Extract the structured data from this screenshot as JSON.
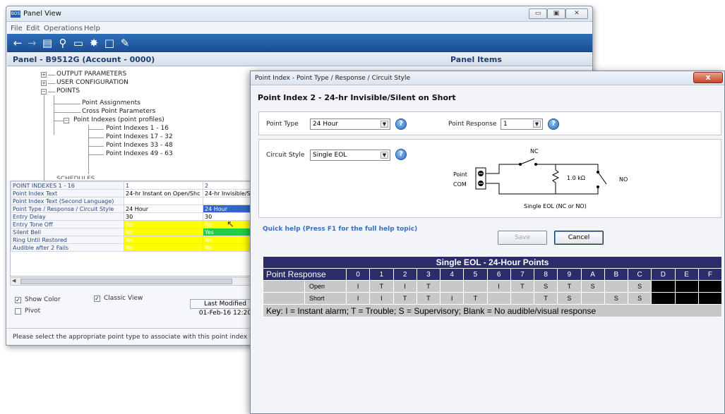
{
  "main_window": {
    "title": "Panel View",
    "app_icon_text": "BOS",
    "caption_buttons": {
      "minimize": "▭",
      "maximize": "▣",
      "close": "✕"
    },
    "menu": [
      "File",
      "Edit",
      "Operations",
      "Help"
    ],
    "toolbar_icons": [
      "back-arrow-icon",
      "forward-arrow-icon",
      "preview-icon",
      "search-icon",
      "page-security-icon",
      "tools-icon",
      "document-icon",
      "edit-document-icon"
    ],
    "panel_title": "Panel - B9512G (Account - 0000)",
    "panel_items_title": "Panel Items",
    "tree": {
      "output_parameters": "OUTPUT PARAMETERS",
      "user_configuration": "USER CONFIGURATION",
      "points": "POINTS",
      "point_assignments": "Point Assignments",
      "cross_point": "Cross Point Parameters",
      "point_indexes": "Point Indexes (point profiles)",
      "pi_1_16": "Point Indexes 1 - 16",
      "pi_17_32": "Point Indexes 17 - 32",
      "pi_33_48": "Point Indexes 33 - 48",
      "pi_49_63": "Point Indexes 49 - 63",
      "schedules_partial": "SCHEDULES"
    },
    "grid": {
      "header": [
        "POINT INDEXES 1 - 16",
        "1",
        "2"
      ],
      "rows": [
        {
          "label": "Point Index Text",
          "c1": "24-hr Instant on Open/Shc",
          "c2": "24-hr Invisible/S"
        },
        {
          "label": "Point Index Text (Second Language)",
          "c1": "",
          "c2": ""
        },
        {
          "label": "Point Type / Response / Circuit Style",
          "c1": "24 Hour",
          "c2": "24 Hour"
        },
        {
          "label": "Entry Delay",
          "c1": "30",
          "c2": "30"
        },
        {
          "label": "Entry Tone Off",
          "c1": "No",
          "c2": "No"
        },
        {
          "label": "Silent Bell",
          "c1": "No",
          "c2": "Yes"
        },
        {
          "label": "Ring Until Restored",
          "c1": "No",
          "c2": "No"
        },
        {
          "label": "Audible after 2 Fails",
          "c1": "No",
          "c2": "No"
        }
      ]
    },
    "show_color_label": "Show Color",
    "classic_view_label": "Classic View",
    "pivot_label": "Pivot",
    "last_modified_label": "Last Modified",
    "last_modified_value": "01-Feb-16 12:20",
    "status_text": "Please select the appropriate point type to associate with this point index from the d"
  },
  "dialog": {
    "title": "Point Index - Point Type / Response / Circuit Style",
    "close_label": "x",
    "heading": "Point Index 2 - 24-hr Invisible/Silent on Short",
    "point_type_label": "Point Type",
    "point_type_value": "24 Hour",
    "point_response_label": "Point Response",
    "point_response_value": "1",
    "circuit_style_label": "Circuit Style",
    "circuit_style_value": "Single EOL",
    "diagram": {
      "nc": "NC",
      "no": "NO",
      "point": "Point",
      "com": "COM",
      "resistor": "1.0 kΩ",
      "caption": "Single EOL (NC or NO)"
    },
    "quick_help": "Quick help (Press F1 for the full help topic)",
    "save_label": "Save",
    "cancel_label": "Cancel",
    "response_table": {
      "title": "Single EOL - 24-Hour Points",
      "header_label": "Point Response",
      "columns": [
        "0",
        "1",
        "2",
        "3",
        "4",
        "5",
        "6",
        "7",
        "8",
        "9",
        "A",
        "B",
        "C",
        "D",
        "E",
        "F"
      ],
      "rows": [
        {
          "label": "Open",
          "cells": [
            "I",
            "T",
            "I",
            "T",
            "",
            "",
            "I",
            "T",
            "S",
            "T",
            "S",
            "",
            "S",
            "",
            "",
            ""
          ]
        },
        {
          "label": "Short",
          "cells": [
            "I",
            "I",
            "T",
            "T",
            "I",
            "T",
            "",
            "",
            "T",
            "S",
            "",
            "S",
            "S",
            "",
            "",
            ""
          ]
        }
      ],
      "key": "Key: I = Instant alarm; T = Trouble; S = Supervisory; Blank = No audible/visual response"
    }
  }
}
